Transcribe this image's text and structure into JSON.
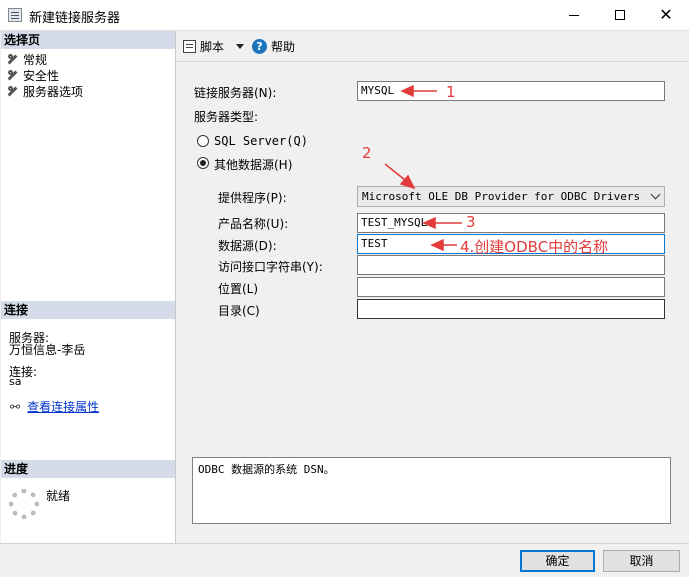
{
  "window": {
    "title": "新建链接服务器",
    "minimize": "",
    "maximize": "",
    "close": "✕"
  },
  "left": {
    "select_page_header": "选择页",
    "pages": [
      {
        "label": "常规"
      },
      {
        "label": "安全性"
      },
      {
        "label": "服务器选项"
      }
    ],
    "connection_header": "连接",
    "server_label": "服务器:",
    "server_value": "万恒信息-李岳",
    "connection_label": "连接:",
    "connection_value": "sa",
    "view_link": "查看连接属性",
    "progress_header": "进度",
    "progress_status": "就绪"
  },
  "toolbar": {
    "script_label": "脚本",
    "help_label": "帮助"
  },
  "form": {
    "linked_server_label": "链接服务器(N):",
    "linked_server_value": "MYSQL",
    "server_type_label": "服务器类型:",
    "sqlserver_option": "SQL Server(Q)",
    "other_option": "其他数据源(H)",
    "provider_label": "提供程序(P):",
    "provider_value": "Microsoft OLE DB Provider for ODBC Drivers",
    "product_label": "产品名称(U):",
    "product_value": "TEST_MYSQL",
    "datasource_label": "数据源(D):",
    "datasource_value": "TEST",
    "providerstring_label": "访问接口字符串(Y):",
    "providerstring_value": "",
    "location_label": "位置(L)",
    "location_value": "",
    "catalog_label": "目录(C)",
    "catalog_value": ""
  },
  "description": "ODBC 数据源的系统 DSN。",
  "buttons": {
    "ok": "确定",
    "cancel": "取消"
  },
  "annotations": {
    "a1": "1",
    "a2": "2",
    "a3": "3",
    "a4": "4.创建ODBC中的名称",
    "color": "#e23b3b"
  }
}
